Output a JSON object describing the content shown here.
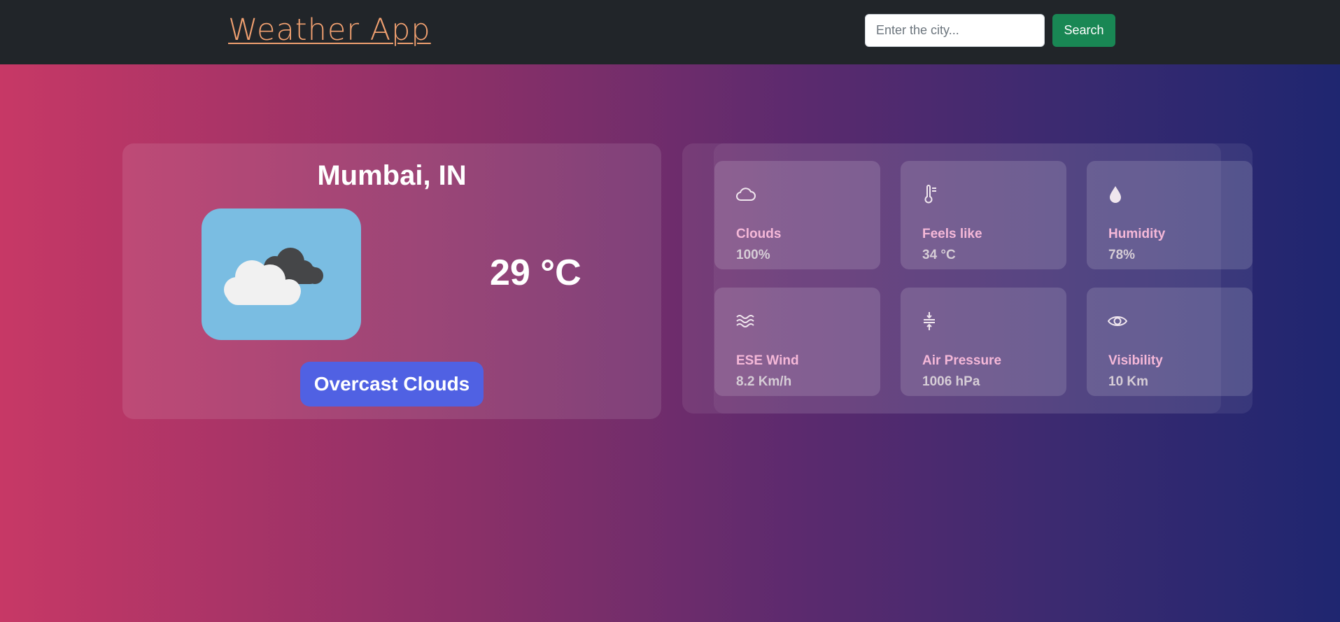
{
  "navbar": {
    "brand": "Weather App",
    "search_placeholder": "Enter the city...",
    "search_label": "Search"
  },
  "current": {
    "city": "Mumbai, IN",
    "temperature": "29 °C",
    "description": "Overcast Clouds",
    "icon": "overcast-clouds-icon"
  },
  "details": [
    {
      "icon": "cloud-icon",
      "label": "Clouds",
      "value": "100%"
    },
    {
      "icon": "thermometer-icon",
      "label": "Feels like",
      "value": "34 °C"
    },
    {
      "icon": "droplet-icon",
      "label": "Humidity",
      "value": "78%"
    },
    {
      "icon": "wind-icon",
      "label": "ESE Wind",
      "value": "8.2 Km/h"
    },
    {
      "icon": "pressure-icon",
      "label": "Air Pressure",
      "value": "1006 hPa"
    },
    {
      "icon": "eye-icon",
      "label": "Visibility",
      "value": "10 Km"
    }
  ],
  "colors": {
    "navbar_bg": "#212529",
    "brand": "#f0a070",
    "search_button": "#198754",
    "description_badge": "#5061e3",
    "label_pink": "#f5b8d8"
  }
}
